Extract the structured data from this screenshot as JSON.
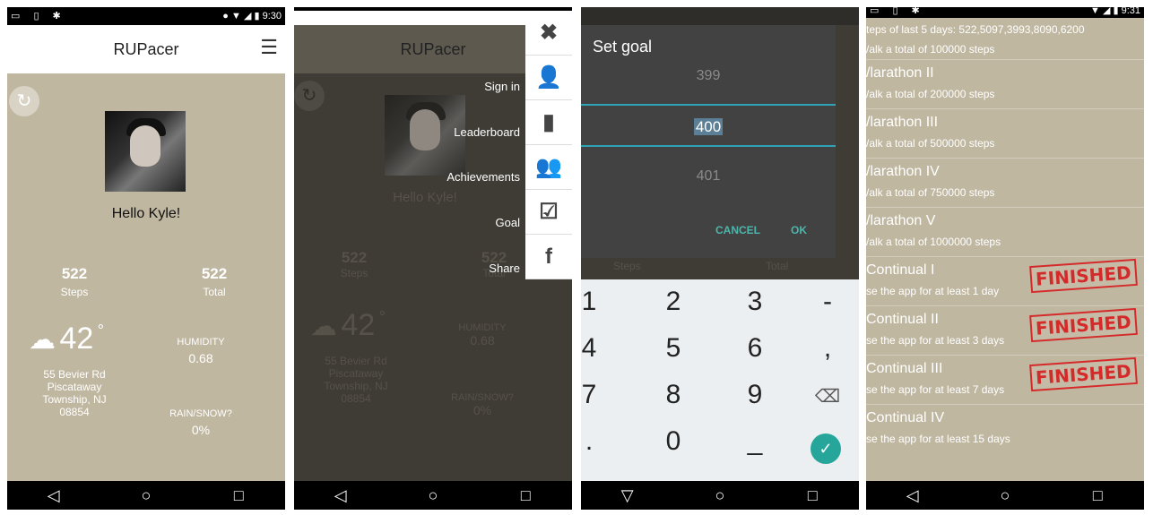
{
  "status": {
    "time_1": "9:30",
    "time_4": "9:31"
  },
  "app": {
    "title": "RUPacer"
  },
  "home": {
    "greeting": "Hello Kyle!",
    "steps_value": "522",
    "steps_label": "Steps",
    "total_value": "522",
    "total_label": "Total",
    "temperature": "42",
    "degree": "°",
    "address_line1": "55 Bevier Rd",
    "address_line2": "Piscataway",
    "address_line3": "Township, NJ",
    "address_line4": "08854",
    "humidity_label": "HUMIDITY",
    "humidity_value": "0.68",
    "rain_label": "RAIN/SNOW?",
    "rain_value": "0%"
  },
  "drawer": {
    "items": [
      {
        "label": "Sign in",
        "icon": "person-add-icon",
        "glyph": "👤"
      },
      {
        "label": "Leaderboard",
        "icon": "leaderboard-icon",
        "glyph": "▮"
      },
      {
        "label": "Achievements",
        "icon": "group-icon",
        "glyph": "👥"
      },
      {
        "label": "Goal",
        "icon": "checkbox-icon",
        "glyph": "☑"
      },
      {
        "label": "Share",
        "icon": "facebook-icon",
        "glyph": "f"
      }
    ],
    "close_glyph": "✖"
  },
  "goal_dialog": {
    "title": "Set goal",
    "prev": "399",
    "current": "400",
    "next": "401",
    "cancel": "CANCEL",
    "ok": "OK",
    "behind_steps": "Steps",
    "behind_total": "Total"
  },
  "keypad": {
    "keys": [
      "1",
      "2",
      "3",
      "-",
      "4",
      "5",
      "6",
      ",",
      "7",
      "8",
      "9",
      "⌫",
      ".",
      "0",
      "_",
      "✓"
    ]
  },
  "achievements": {
    "header": "teps of last 5 days: 522,5097,3993,8090,6200",
    "first_desc": "/alk a total of 100000 steps",
    "items": [
      {
        "name": "/larathon II",
        "desc": "/alk a total of 200000 steps",
        "finished": false
      },
      {
        "name": "/larathon III",
        "desc": "/alk a total of 500000 steps",
        "finished": false
      },
      {
        "name": "/larathon IV",
        "desc": "/alk a total of 750000 steps",
        "finished": false
      },
      {
        "name": "/larathon V",
        "desc": "/alk a total of 1000000 steps",
        "finished": false
      },
      {
        "name": "Continual I",
        "desc": "se the app for at least 1 day",
        "finished": true
      },
      {
        "name": "Continual II",
        "desc": "se the app for at least 3 days",
        "finished": true
      },
      {
        "name": "Continual III",
        "desc": "se the app for at least 7 days",
        "finished": true
      },
      {
        "name": "Continual IV",
        "desc": "se the app for at least 15 days",
        "finished": false
      }
    ],
    "stamp_text": "FINISHED"
  },
  "nav": {
    "back": "◁",
    "home": "○",
    "recents": "□",
    "down": "▽"
  },
  "colors": {
    "beige": "#c0b7a1",
    "teal": "#26a69a",
    "accent_line": "#2ea3b5",
    "stamp_red": "#d52a2a"
  }
}
